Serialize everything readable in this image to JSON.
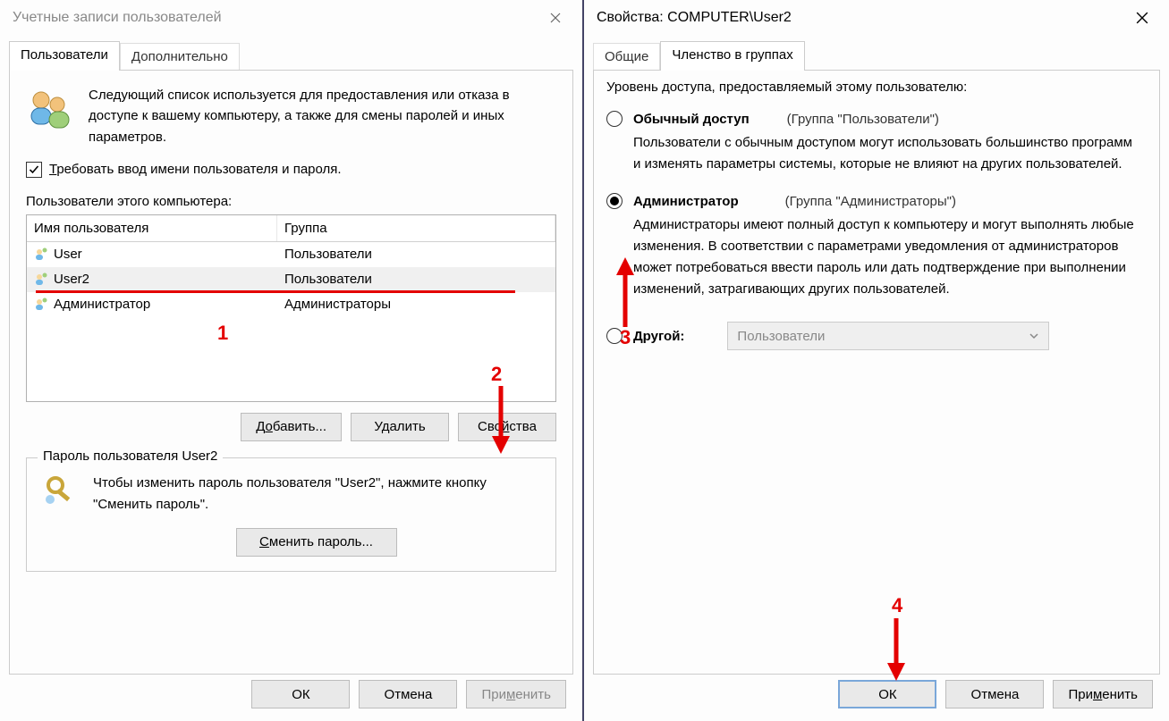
{
  "left": {
    "title": "Учетные записи пользователей",
    "tabs": {
      "users": "Пользователи",
      "advanced": "Дополнительно"
    },
    "intro": "Следующий список используется для предоставления или отказа в доступе к вашему компьютеру, а также для смены паролей и иных параметров.",
    "require_creds_prefix": "Т",
    "require_creds_rest": "ребовать ввод имени пользователя и пароля.",
    "users_list_label": "Пользователи этого компьютера:",
    "columns": {
      "name": "Имя пользователя",
      "group": "Группа"
    },
    "rows": [
      {
        "name": "User",
        "group": "Пользователи"
      },
      {
        "name": "User2",
        "group": "Пользователи",
        "selected": true
      },
      {
        "name": "Администратор",
        "group": "Администраторы"
      }
    ],
    "buttons": {
      "add_pre": "Д",
      "add_mid": "о",
      "add_post": "бавить...",
      "remove": "Удалить",
      "props_pre": "Сво",
      "props_mid": "й",
      "props_post": "ства"
    },
    "groupbox_title": "Пароль пользователя User2",
    "groupbox_text": "Чтобы изменить пароль пользователя \"User2\", нажмите кнопку \"Сменить пароль\".",
    "change_pwd_pre": "С",
    "change_pwd_rest": "менить пароль...",
    "footer": {
      "ok": "ОК",
      "cancel": "Отмена",
      "apply_pre": "При",
      "apply_mid": "м",
      "apply_post": "енить"
    }
  },
  "right": {
    "title": "Свойства: COMPUTER\\User2",
    "tabs": {
      "general": "Общие",
      "membership": "Членство в группах"
    },
    "access_label": "Уровень доступа, предоставляемый этому пользователю:",
    "std": {
      "label": "Обычный доступ",
      "group": "(Группа \"Пользователи\")",
      "desc": "Пользователи с обычным доступом могут использовать большинство программ и изменять параметры системы, которые не влияют на других пользователей."
    },
    "admin": {
      "label": "Администратор",
      "group": "(Группа \"Администраторы\")",
      "desc": "Администраторы имеют полный доступ к компьютеру и могут выполнять любые изменения. В соответствии с параметрами уведомления от администраторов может потребоваться ввести пароль или дать подтверждение при выполнении изменений, затрагивающих других пользователей."
    },
    "other": {
      "label": "Другой:",
      "combo": "Пользователи"
    },
    "footer": {
      "ok": "ОК",
      "cancel": "Отмена",
      "apply_pre": "При",
      "apply_mid": "м",
      "apply_post": "енить"
    }
  },
  "annotations": {
    "n1": "1",
    "n2": "2",
    "n3": "3",
    "n4": "4"
  }
}
